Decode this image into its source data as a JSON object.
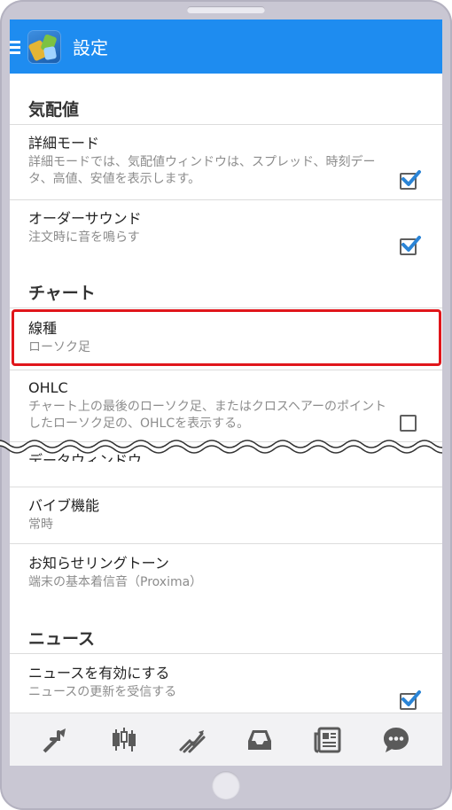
{
  "app": {
    "title": "設定",
    "logo_icon": "metatrader-logo-icon",
    "accent_color": "#1e8cf0"
  },
  "sections": {
    "quotes": {
      "header": "気配値",
      "detail_mode": {
        "title": "詳細モード",
        "subtitle": "詳細モードでは、気配値ウィンドウは、スプレッド、時刻データ、高値、安値を表示します。",
        "checked": true
      },
      "order_sound": {
        "title": "オーダーサウンド",
        "subtitle": "注文時に音を鳴らす",
        "checked": true
      }
    },
    "chart": {
      "header": "チャート",
      "line_type": {
        "title": "線種",
        "value": "ローソク足",
        "highlight_color": "#e0161b"
      },
      "ohlc": {
        "title": "OHLC",
        "subtitle": "チャート上の最後のローソク足、またはクロスヘアーのポイントしたローソク足の、OHLCを表示する。",
        "checked": false
      },
      "data_window": {
        "title": "データウィンドウ"
      },
      "vibration": {
        "title": "バイブ機能",
        "value": "常時"
      },
      "ringtone": {
        "title": "お知らせリングトーン",
        "value": "端末の基本着信音（Proxima）"
      }
    },
    "news": {
      "header": "ニュース",
      "enable_news": {
        "title": "ニュースを有効にする",
        "subtitle": "ニュースの更新を受信する",
        "checked": true
      }
    }
  },
  "toolbar": {
    "items": [
      {
        "icon": "quotes-arrows-icon"
      },
      {
        "icon": "chart-candles-icon"
      },
      {
        "icon": "trade-icon"
      },
      {
        "icon": "history-inbox-icon"
      },
      {
        "icon": "news-icon"
      },
      {
        "icon": "chat-icon"
      }
    ],
    "icon_color": "#5a5a5a"
  }
}
